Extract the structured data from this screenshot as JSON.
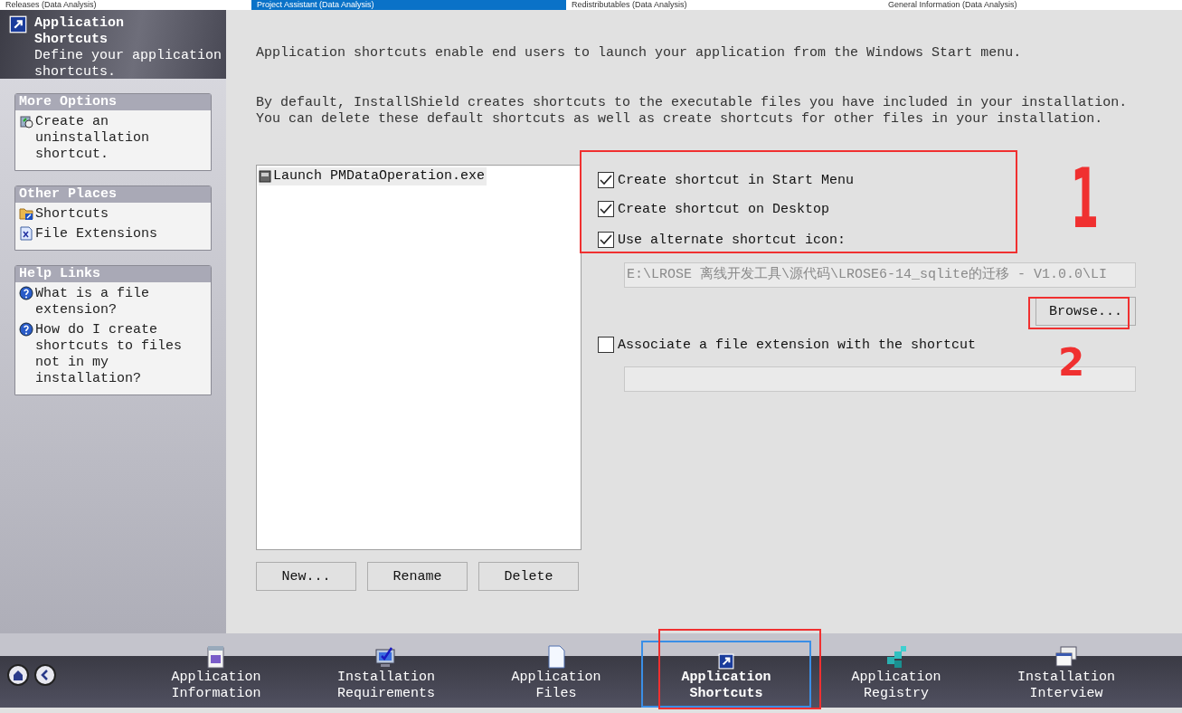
{
  "tabs": [
    {
      "label": "Releases (Data Analysis)",
      "selected": false
    },
    {
      "label": "Project Assistant (Data Analysis)",
      "selected": true
    },
    {
      "label": "Redistributables (Data Analysis)",
      "selected": false
    },
    {
      "label": "General Information (Data Analysis)",
      "selected": false
    }
  ],
  "header": {
    "title": "Application Shortcuts",
    "subtitle": "Define your application shortcuts."
  },
  "sidebar": [
    {
      "title": "More Options",
      "items": [
        {
          "label": "Create an uninstallation shortcut."
        }
      ]
    },
    {
      "title": "Other Places",
      "items": [
        {
          "label": "Shortcuts"
        },
        {
          "label": "File Extensions"
        }
      ]
    },
    {
      "title": "Help Links",
      "items": [
        {
          "label": "What is a file extension?"
        },
        {
          "label": "How do I create shortcuts to files not in my installation?"
        }
      ]
    }
  ],
  "intro": [
    "Application shortcuts enable end users to launch your application from the Windows Start menu.",
    "By default, InstallShield creates shortcuts to the executable files you have included in your installation. You can delete these default shortcuts as well as create shortcuts for other files in your installation."
  ],
  "shortcuts": [
    {
      "label": "Launch PMDataOperation.exe",
      "selected": true
    }
  ],
  "list_buttons": [
    "New...",
    "Rename",
    "Delete"
  ],
  "options": [
    {
      "label": "Create shortcut in Start Menu",
      "checked": true
    },
    {
      "label": "Create shortcut on Desktop",
      "checked": true
    },
    {
      "label": "Use alternate shortcut icon:",
      "checked": true
    }
  ],
  "icon_path": {
    "value": "E:\\LROSE 离线开发工具\\源代码\\LROSE6-14_sqlite的迁移 - V1.0.0\\LI"
  },
  "browse_button": "Browse...",
  "associate": {
    "label": "Associate a file extension with the shortcut",
    "checked": false
  },
  "nav": [
    {
      "label": "Application Information",
      "selected": false
    },
    {
      "label": "Installation Requirements",
      "selected": false
    },
    {
      "label": "Application Files",
      "selected": false
    },
    {
      "label": "Application Shortcuts",
      "selected": true
    },
    {
      "label": "Application Registry",
      "selected": false
    },
    {
      "label": "Installation Interview",
      "selected": false
    }
  ],
  "annotations": [
    "1",
    "2"
  ]
}
